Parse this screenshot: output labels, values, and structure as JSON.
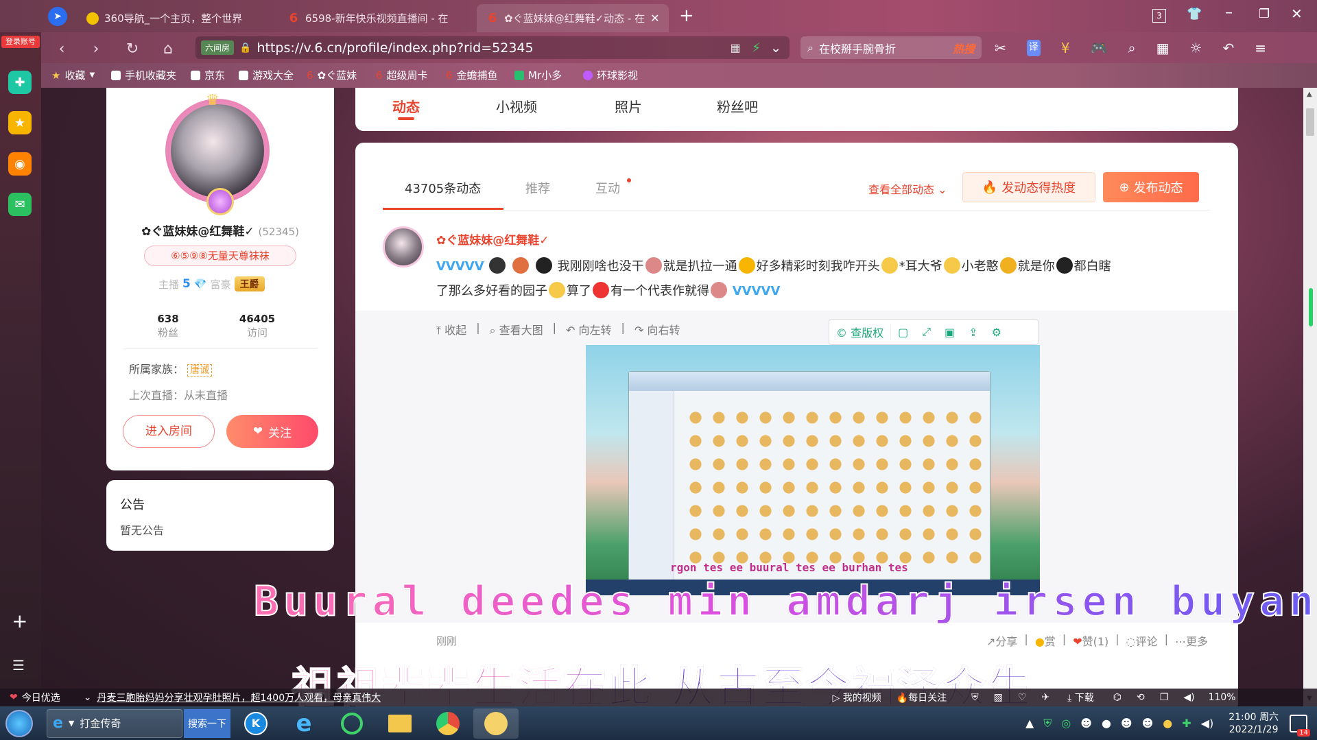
{
  "browser": {
    "tabs": [
      {
        "title": "360导航_一个主页，整个世界",
        "icon_color": "#f2c200"
      },
      {
        "title": "6598-新年快乐视频直播间 - 在",
        "icon_color": "#e8442e"
      },
      {
        "title": "✿ぐ蓝妹妹@红舞鞋✓动态 - 在",
        "icon_color": "#e8442e"
      }
    ],
    "tab_count": "3",
    "address_prefix": "六间房",
    "url": "https://v.6.cn/profile/index.php?rid=52345",
    "search_text": "在校掰手腕骨折",
    "search_hot": "热搜",
    "bookmarks": [
      "收藏",
      "手机收藏夹",
      "京东",
      "游戏大全",
      "✿ぐ蓝妹",
      "超级周卡",
      "金蟾捕鱼",
      "Mr小多",
      "环球影视"
    ],
    "login_label": "登录账号"
  },
  "profile": {
    "name": "✿ぐ蓝妹妹@红舞鞋✓",
    "rid": "(52345)",
    "family_badge": "⑥⑤⑨⑧无量天尊袜袜",
    "anchor_label": "主播",
    "anchor_level": "5",
    "rich_label": "富豪",
    "rich_title": "王爵",
    "fans_count": "638",
    "fans_label": "粉丝",
    "visits_count": "46405",
    "visits_label": "访问",
    "family_label": "所属家族：",
    "family_name": "唐诚",
    "last_live": "上次直播：从未直播",
    "enter_room": "进入房间",
    "follow": "关注"
  },
  "notice": {
    "title": "公告",
    "body": "暂无公告"
  },
  "main_tabs": [
    "动态",
    "小视频",
    "照片",
    "粉丝吧"
  ],
  "feed": {
    "subtabs": [
      "43705条动态",
      "推荐",
      "互动"
    ],
    "view_all": "查看全部动态",
    "hot_btn": "发动态得热度",
    "post_btn": "发布动态",
    "post": {
      "author": "✿ぐ蓝妹妹@红舞鞋✓",
      "text_line1_a": "我刚刚啥也没干",
      "text_line1_b": "就是扒拉一通",
      "text_line1_c": "好多精彩时刻我咋开头",
      "text_line1_d": "*耳大爷",
      "text_line1_e": "小老憨",
      "text_line1_f": "就是你",
      "text_line1_g": "都白瞎",
      "text_line2_a": "了那么多好看的园子",
      "text_line2_b": "算了",
      "text_line2_c": "有一个代表作就得",
      "tools": [
        "收起",
        "查看大图",
        "向左转",
        "向右转"
      ],
      "copyright": "查版权",
      "time": "刚刚",
      "actions": [
        "分享",
        "赏",
        "赞(1)",
        "评论",
        "更多"
      ]
    },
    "image_caption": "rgon tes ee buural tes ee burhan tes"
  },
  "subtitles": {
    "line1": "Buural deedes min amdarj irsen buyan",
    "line2": "祖祖辈辈生活在此 从古至今福泽众生"
  },
  "statusbar": {
    "today": "今日优选",
    "news": "丹麦三胞胎妈妈分享壮观孕肚照片，超1400万人观看，母亲真伟大",
    "my_video": "我的视频",
    "daily": "每日关注",
    "download": "下载",
    "zoom": "110%"
  },
  "taskbar": {
    "app1": "打金传奇",
    "search_btn": "搜索一下",
    "time": "21:00 周六",
    "date": "2022/1/29",
    "badge": "14"
  }
}
